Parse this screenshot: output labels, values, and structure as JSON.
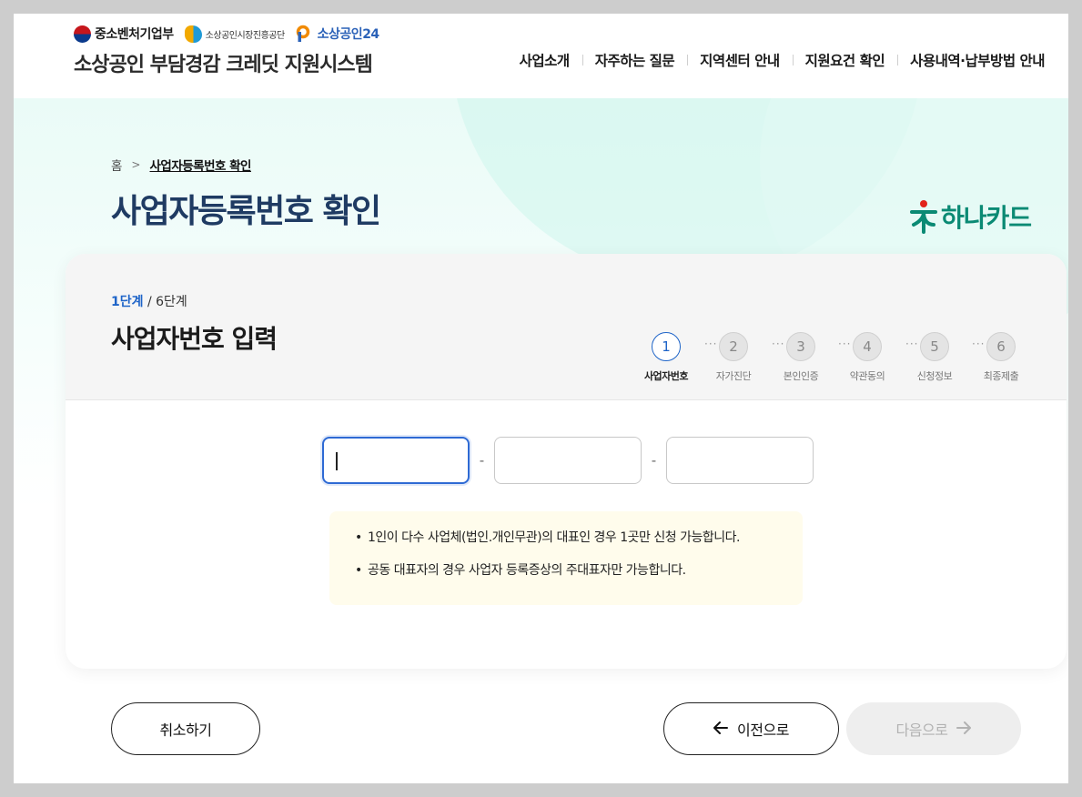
{
  "header": {
    "logos": {
      "ministry": "중소벤처기업부",
      "agency": "소상공인시장진흥공단",
      "portal": "소상공인24"
    },
    "site_title": "소상공인 부담경감 크레딧 지원시스템",
    "nav": [
      "사업소개",
      "자주하는 질문",
      "지역센터 안내",
      "지원요건 확인",
      "사용내역·납부방법 안내"
    ]
  },
  "breadcrumb": {
    "home": "홈",
    "current": "사업자등록번호 확인"
  },
  "page_title": "사업자등록번호 확인",
  "card_brand": "하나카드",
  "form": {
    "step_current": "1단계",
    "step_total": " / 6단계",
    "title": "사업자번호 입력",
    "steps": [
      {
        "num": "1",
        "label": "사업자번호",
        "active": true
      },
      {
        "num": "2",
        "label": "자가진단",
        "active": false
      },
      {
        "num": "3",
        "label": "본인인증",
        "active": false
      },
      {
        "num": "4",
        "label": "약관동의",
        "active": false
      },
      {
        "num": "5",
        "label": "신청정보",
        "active": false
      },
      {
        "num": "6",
        "label": "최종제출",
        "active": false
      }
    ],
    "step_separator": "···",
    "bizno": {
      "part1": "",
      "part2": "",
      "part3": "",
      "dash": "-"
    },
    "notices": [
      "1인이 다수 사업체(법인.개인무관)의 대표인 경우 1곳만 신청 가능합니다.",
      "공동 대표자의 경우 사업자 등록증상의 주대표자만 가능합니다."
    ]
  },
  "buttons": {
    "cancel": "취소하기",
    "prev": "이전으로",
    "next": "다음으로",
    "prev_icon": "arrow-left-icon",
    "next_icon": "arrow-right-icon",
    "next_enabled": false
  },
  "colors": {
    "accent": "#1e64c8",
    "title": "#1f3b63",
    "hana_green": "#0a8a74",
    "notice_bg": "#fffcec"
  }
}
